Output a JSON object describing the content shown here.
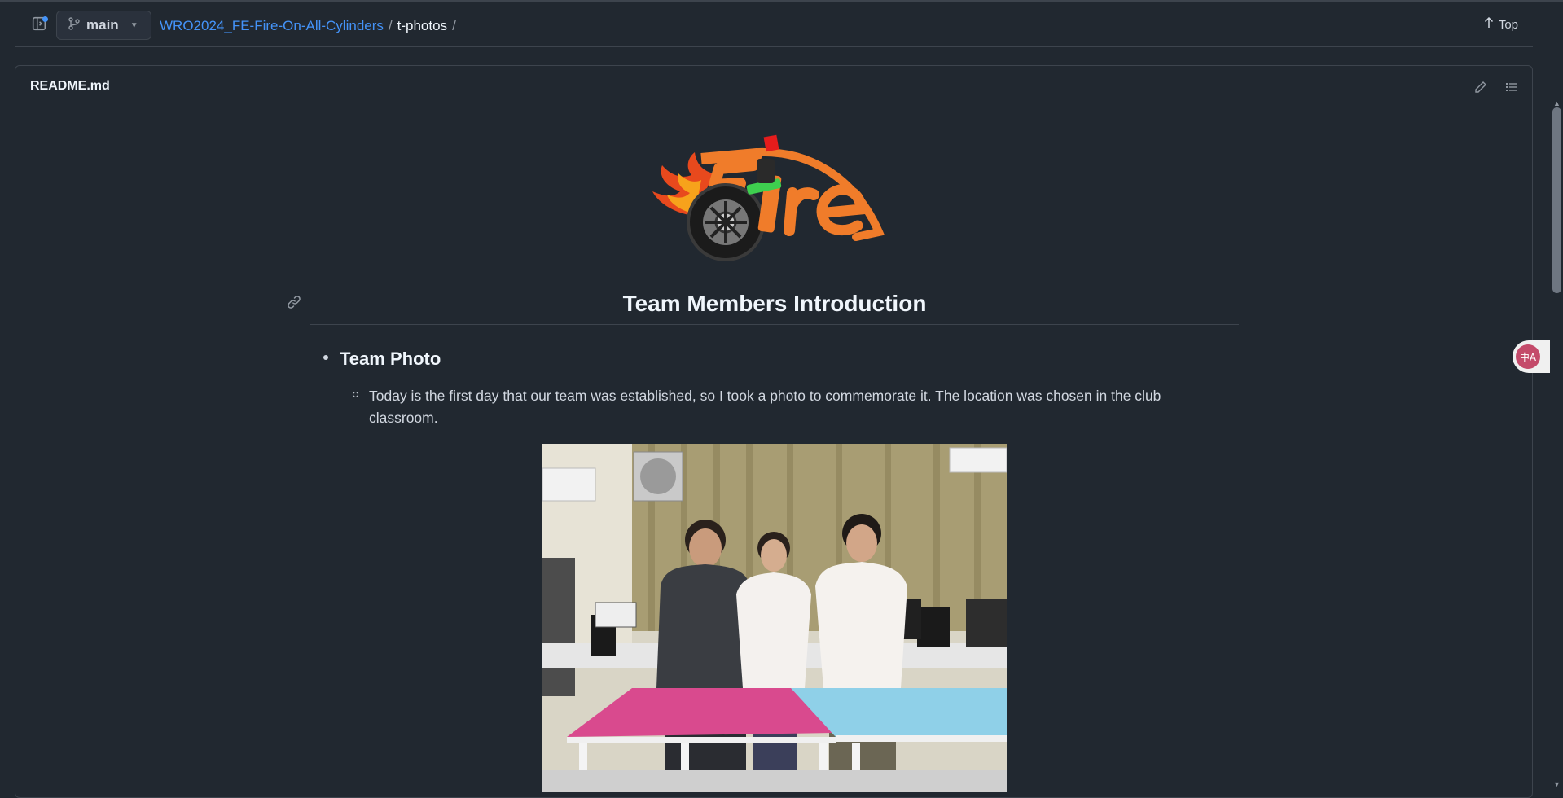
{
  "toolbar": {
    "branch": "main",
    "repo": "WRO2024_FE-Fire-On-All-Cylinders",
    "separator": "/",
    "folder": "t-photos",
    "top_label": "Top"
  },
  "readme": {
    "filename": "README.md",
    "heading": "Team Members Introduction",
    "section_title": "Team Photo",
    "paragraph": "Today is the first day that our team was established, so I took a photo to commemorate it. The location was chosen in the club classroom."
  },
  "translate_fab": {
    "label": "中A"
  },
  "colors": {
    "background": "#212830",
    "border": "#3d444d",
    "link": "#4493f8",
    "text": "#d1d7e0",
    "logo_orange": "#f07c2a"
  },
  "icons": [
    "sidebar-toggle-icon",
    "git-branch-icon",
    "chevron-down-icon",
    "arrow-up-icon",
    "pencil-icon",
    "list-icon",
    "link-icon",
    "translate-icon"
  ]
}
